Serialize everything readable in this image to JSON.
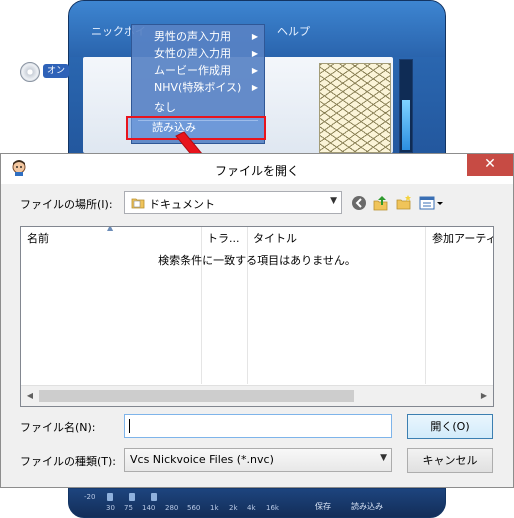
{
  "background_app": {
    "menu": {
      "nickvoice": "ニックボイ",
      "help": "ヘルプ"
    },
    "on_badge": "オン",
    "db_label": "-20",
    "eq_ticks": [
      "30",
      "75",
      "140",
      "280",
      "560",
      "1k",
      "2k",
      "4k",
      "16k"
    ],
    "footer": {
      "save": "保存",
      "load": "読み込み"
    }
  },
  "context_menu": {
    "items": [
      {
        "label": "男性の声入力用",
        "has_submenu": true
      },
      {
        "label": "女性の声入力用",
        "has_submenu": true
      },
      {
        "label": "ムービー作成用",
        "has_submenu": true
      },
      {
        "label": "NHV(特殊ボイス)",
        "has_submenu": true
      },
      {
        "label": "なし",
        "has_submenu": false
      },
      {
        "label": "読み込み",
        "has_submenu": false,
        "highlighted": true
      }
    ]
  },
  "dialog": {
    "title": "ファイルを開く",
    "close_glyph": "✕",
    "look_in_label": "ファイルの場所(I):",
    "look_in_value": "ドキュメント",
    "columns": [
      "名前",
      "トラ...",
      "タイトル",
      "参加アーティ"
    ],
    "empty_message": "検索条件に一致する項目はありません。",
    "filename_label": "ファイル名(N):",
    "filename_value": "",
    "filetype_label": "ファイルの種類(T):",
    "filetype_value": "Vcs Nickvoice Files (*.nvc)",
    "open_label": "開く(O)",
    "cancel_label": "キャンセル"
  },
  "colors": {
    "annotation_red": "#e8141d",
    "app_blue": "#2a64ad",
    "close_red": "#c74b44"
  },
  "icons": [
    "back-icon",
    "up-folder-icon",
    "new-folder-icon",
    "view-menu-icon",
    "folder-icon",
    "app-icon"
  ]
}
